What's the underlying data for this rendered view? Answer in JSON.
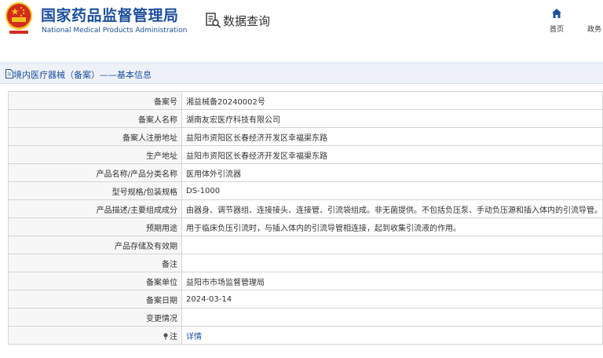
{
  "header": {
    "org_cn": "国家药品监督管理局",
    "org_en": "National Medical Products Administration",
    "data_search_label": "数据查询",
    "nav_home_label": "首页",
    "nav_next_label": "政务"
  },
  "page_title": "境内医疗器械（备案）——基本信息",
  "rows": [
    {
      "label": "备案号",
      "value": "湘益械备20240002号"
    },
    {
      "label": "备案人名称",
      "value": "湖南友宏医疗科技有限公司"
    },
    {
      "label": "备案人注册地址",
      "value": "益阳市资阳区长春经济开发区幸福渠东路"
    },
    {
      "label": "生产地址",
      "value": "益阳市资阳区长春经济开发区幸福渠东路"
    },
    {
      "label": "产品名称/产品分类名称",
      "value": "医用体外引流器"
    },
    {
      "label": "型号规格/包装规格",
      "value": "DS-1000"
    },
    {
      "label": "产品描述/主要组成成分",
      "value": "由器身、调节器组、连接接头、连接管、引流袋组成。非无菌提供。不包括负压泵、手动负压源和插入体内的引流导管。"
    },
    {
      "label": "预期用途",
      "value": "用于临床负压引流时，与插入体内的引流导管相连接，起到收集引流液的作用。"
    },
    {
      "label": "产品存储及有效期",
      "value": ""
    },
    {
      "label": "备注",
      "value": ""
    },
    {
      "label": "备案单位",
      "value": "益阳市市场监督管理局"
    },
    {
      "label": "备案日期",
      "value": "2024-03-14"
    },
    {
      "label": "变更情况",
      "value": ""
    }
  ],
  "note_row": {
    "label": "注",
    "link_text": "详情"
  },
  "colors": {
    "brand_blue": "#1c4f9c",
    "emblem_red": "#d42a1f",
    "emblem_gold": "#f2c21a"
  }
}
